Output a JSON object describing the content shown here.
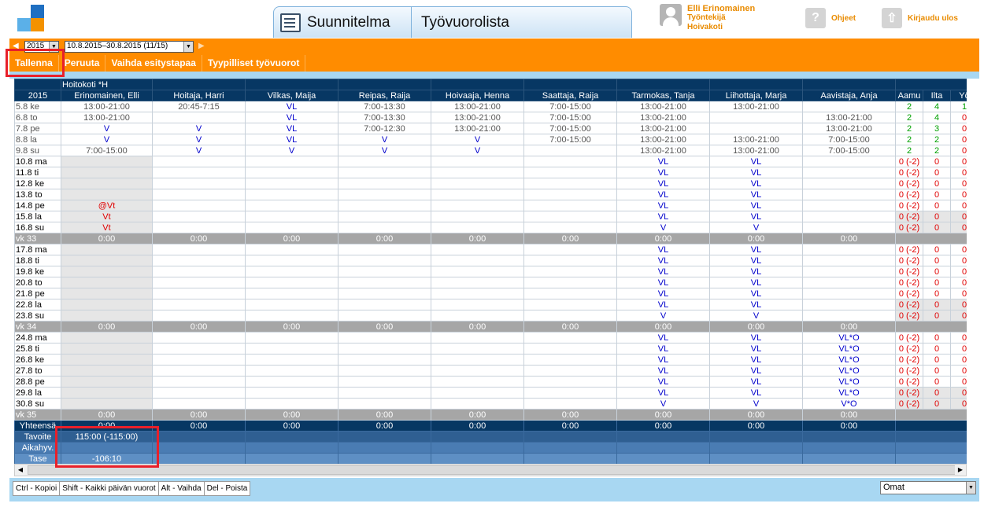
{
  "header": {
    "tab_plan": "Suunnitelma",
    "tab_list": "Työvuorolista",
    "user_name": "Elli Erinomainen",
    "user_role": "Työntekijä",
    "user_unit": "Hoivakoti",
    "help": "Ohjeet",
    "logout": "Kirjaudu ulos"
  },
  "toolbar": {
    "year": "2015",
    "range": "10.8.2015–30.8.2015 (11/15)",
    "save": "Tallenna",
    "cancel": "Peruuta",
    "change_view": "Vaihda esitystapaa",
    "typical": "Tyypilliset työvuorot"
  },
  "colors": {
    "orange": "#ff8c00",
    "header_blue": "#073763",
    "accent": "#e98b00",
    "highlight": "#e8202a"
  },
  "table": {
    "unit": "Hoitokoti *H",
    "year": "2015",
    "employees": [
      "Erinomainen, Elli",
      "Hoitaja, Harri",
      "Vilkas, Maija",
      "Reipas, Raija",
      "Hoivaaja, Henna",
      "Saattaja, Raija",
      "Tarmokas, Tanja",
      "Liihottaja, Marja",
      "Aavistaja, Anja"
    ],
    "count_headers": [
      "Aamu",
      "Ilta",
      "Yö"
    ],
    "rows": [
      {
        "d": "5.8 ke",
        "p": 1,
        "c": [
          "13:00-21:00",
          "20:45-7:15",
          "VL",
          "7:00-13:30",
          "13:00-21:00",
          "7:00-15:00",
          "13:00-21:00",
          "13:00-21:00",
          ""
        ],
        "n": [
          "2",
          "4",
          "1"
        ]
      },
      {
        "d": "6.8 to",
        "p": 1,
        "c": [
          "13:00-21:00",
          "",
          "VL",
          "7:00-13:30",
          "13:00-21:00",
          "7:00-15:00",
          "13:00-21:00",
          "",
          "13:00-21:00"
        ],
        "n": [
          "2",
          "4",
          "0"
        ]
      },
      {
        "d": "7.8 pe",
        "p": 1,
        "c": [
          "V",
          "V",
          "VL",
          "7:00-12:30",
          "13:00-21:00",
          "7:00-15:00",
          "13:00-21:00",
          "",
          "13:00-21:00"
        ],
        "n": [
          "2",
          "3",
          "0"
        ]
      },
      {
        "d": "8.8 la",
        "p": 1,
        "c": [
          "V",
          "V",
          "VL",
          "V",
          "V",
          "7:00-15:00",
          "13:00-21:00",
          "13:00-21:00",
          "7:00-15:00"
        ],
        "n": [
          "2",
          "2",
          "0"
        ]
      },
      {
        "d": "9.8 su",
        "p": 1,
        "c": [
          "7:00-15:00",
          "V",
          "V",
          "V",
          "V",
          "",
          "13:00-21:00",
          "13:00-21:00",
          "7:00-15:00"
        ],
        "n": [
          "2",
          "2",
          "0"
        ]
      },
      {
        "d": "10.8 ma",
        "c": [
          "",
          "",
          "",
          "",
          "",
          "",
          "VL",
          "VL",
          ""
        ],
        "n": [
          "0 (-2)",
          "0",
          "0"
        ]
      },
      {
        "d": "11.8 ti",
        "c": [
          "",
          "",
          "",
          "",
          "",
          "",
          "VL",
          "VL",
          ""
        ],
        "n": [
          "0 (-2)",
          "0",
          "0"
        ]
      },
      {
        "d": "12.8 ke",
        "c": [
          "",
          "",
          "",
          "",
          "",
          "",
          "VL",
          "VL",
          ""
        ],
        "n": [
          "0 (-2)",
          "0",
          "0"
        ]
      },
      {
        "d": "13.8 to",
        "c": [
          "",
          "",
          "",
          "",
          "",
          "",
          "VL",
          "VL",
          ""
        ],
        "n": [
          "0 (-2)",
          "0",
          "0"
        ]
      },
      {
        "d": "14.8 pe",
        "c": [
          "@Vt",
          "",
          "",
          "",
          "",
          "",
          "VL",
          "VL",
          ""
        ],
        "n": [
          "0 (-2)",
          "0",
          "0"
        ]
      },
      {
        "d": "15.8 la",
        "c": [
          "Vt",
          "",
          "",
          "",
          "",
          "",
          "VL",
          "VL",
          ""
        ],
        "n": [
          "0 (-2)",
          "0",
          "0"
        ],
        "sh": 1
      },
      {
        "d": "16.8 su",
        "c": [
          "Vt",
          "",
          "",
          "",
          "",
          "",
          "V",
          "V",
          ""
        ],
        "n": [
          "0 (-2)",
          "0",
          "0"
        ],
        "sh": 1
      },
      {
        "d": "vk 33",
        "w": 1,
        "c": [
          "0:00",
          "0:00",
          "0:00",
          "0:00",
          "0:00",
          "0:00",
          "0:00",
          "0:00",
          "0:00"
        ]
      },
      {
        "d": "17.8 ma",
        "c": [
          "",
          "",
          "",
          "",
          "",
          "",
          "VL",
          "VL",
          ""
        ],
        "n": [
          "0 (-2)",
          "0",
          "0"
        ]
      },
      {
        "d": "18.8 ti",
        "c": [
          "",
          "",
          "",
          "",
          "",
          "",
          "VL",
          "VL",
          ""
        ],
        "n": [
          "0 (-2)",
          "0",
          "0"
        ]
      },
      {
        "d": "19.8 ke",
        "c": [
          "",
          "",
          "",
          "",
          "",
          "",
          "VL",
          "VL",
          ""
        ],
        "n": [
          "0 (-2)",
          "0",
          "0"
        ]
      },
      {
        "d": "20.8 to",
        "c": [
          "",
          "",
          "",
          "",
          "",
          "",
          "VL",
          "VL",
          ""
        ],
        "n": [
          "0 (-2)",
          "0",
          "0"
        ]
      },
      {
        "d": "21.8 pe",
        "c": [
          "",
          "",
          "",
          "",
          "",
          "",
          "VL",
          "VL",
          ""
        ],
        "n": [
          "0 (-2)",
          "0",
          "0"
        ]
      },
      {
        "d": "22.8 la",
        "c": [
          "",
          "",
          "",
          "",
          "",
          "",
          "VL",
          "VL",
          ""
        ],
        "n": [
          "0 (-2)",
          "0",
          "0"
        ],
        "sh": 1
      },
      {
        "d": "23.8 su",
        "c": [
          "",
          "",
          "",
          "",
          "",
          "",
          "V",
          "V",
          ""
        ],
        "n": [
          "0 (-2)",
          "0",
          "0"
        ],
        "sh": 1
      },
      {
        "d": "vk 34",
        "w": 1,
        "c": [
          "0:00",
          "0:00",
          "0:00",
          "0:00",
          "0:00",
          "0:00",
          "0:00",
          "0:00",
          "0:00"
        ]
      },
      {
        "d": "24.8 ma",
        "c": [
          "",
          "",
          "",
          "",
          "",
          "",
          "VL",
          "VL",
          "VL*O"
        ],
        "n": [
          "0 (-2)",
          "0",
          "0"
        ]
      },
      {
        "d": "25.8 ti",
        "c": [
          "",
          "",
          "",
          "",
          "",
          "",
          "VL",
          "VL",
          "VL*O"
        ],
        "n": [
          "0 (-2)",
          "0",
          "0"
        ]
      },
      {
        "d": "26.8 ke",
        "c": [
          "",
          "",
          "",
          "",
          "",
          "",
          "VL",
          "VL",
          "VL*O"
        ],
        "n": [
          "0 (-2)",
          "0",
          "0"
        ]
      },
      {
        "d": "27.8 to",
        "c": [
          "",
          "",
          "",
          "",
          "",
          "",
          "VL",
          "VL",
          "VL*O"
        ],
        "n": [
          "0 (-2)",
          "0",
          "0"
        ]
      },
      {
        "d": "28.8 pe",
        "c": [
          "",
          "",
          "",
          "",
          "",
          "",
          "VL",
          "VL",
          "VL*O"
        ],
        "n": [
          "0 (-2)",
          "0",
          "0"
        ]
      },
      {
        "d": "29.8 la",
        "c": [
          "",
          "",
          "",
          "",
          "",
          "",
          "VL",
          "VL",
          "VL*O"
        ],
        "n": [
          "0 (-2)",
          "0",
          "0"
        ],
        "sh": 1
      },
      {
        "d": "30.8 su",
        "c": [
          "",
          "",
          "",
          "",
          "",
          "",
          "V",
          "V",
          "V*O"
        ],
        "n": [
          "0 (-2)",
          "0",
          "0"
        ],
        "sh": 1
      },
      {
        "d": "vk 35",
        "w": 1,
        "c": [
          "0:00",
          "0:00",
          "0:00",
          "0:00",
          "0:00",
          "0:00",
          "0:00",
          "0:00",
          "0:00"
        ]
      }
    ],
    "summary": [
      {
        "label": "Yhteensä",
        "c": [
          "0:00",
          "0:00",
          "0:00",
          "0:00",
          "0:00",
          "0:00",
          "0:00",
          "0:00",
          "0:00"
        ]
      },
      {
        "label": "Tavoite",
        "c": [
          "115:00 (-115:00)",
          "",
          "",
          "",
          "",
          "",
          "",
          "",
          ""
        ]
      },
      {
        "label": "Aikahyv.",
        "c": [
          "",
          "",
          "",
          "",
          "",
          "",
          "",
          "",
          ""
        ]
      },
      {
        "label": "Tase",
        "c": [
          "-106:10",
          "",
          "",
          "",
          "",
          "",
          "",
          "",
          ""
        ]
      }
    ]
  },
  "footer": {
    "hints": [
      "Ctrl - Kopioi",
      "Shift - Kaikki päivän vuorot",
      "Alt - Vaihda",
      "Del - Poista"
    ],
    "view": "Omat"
  }
}
